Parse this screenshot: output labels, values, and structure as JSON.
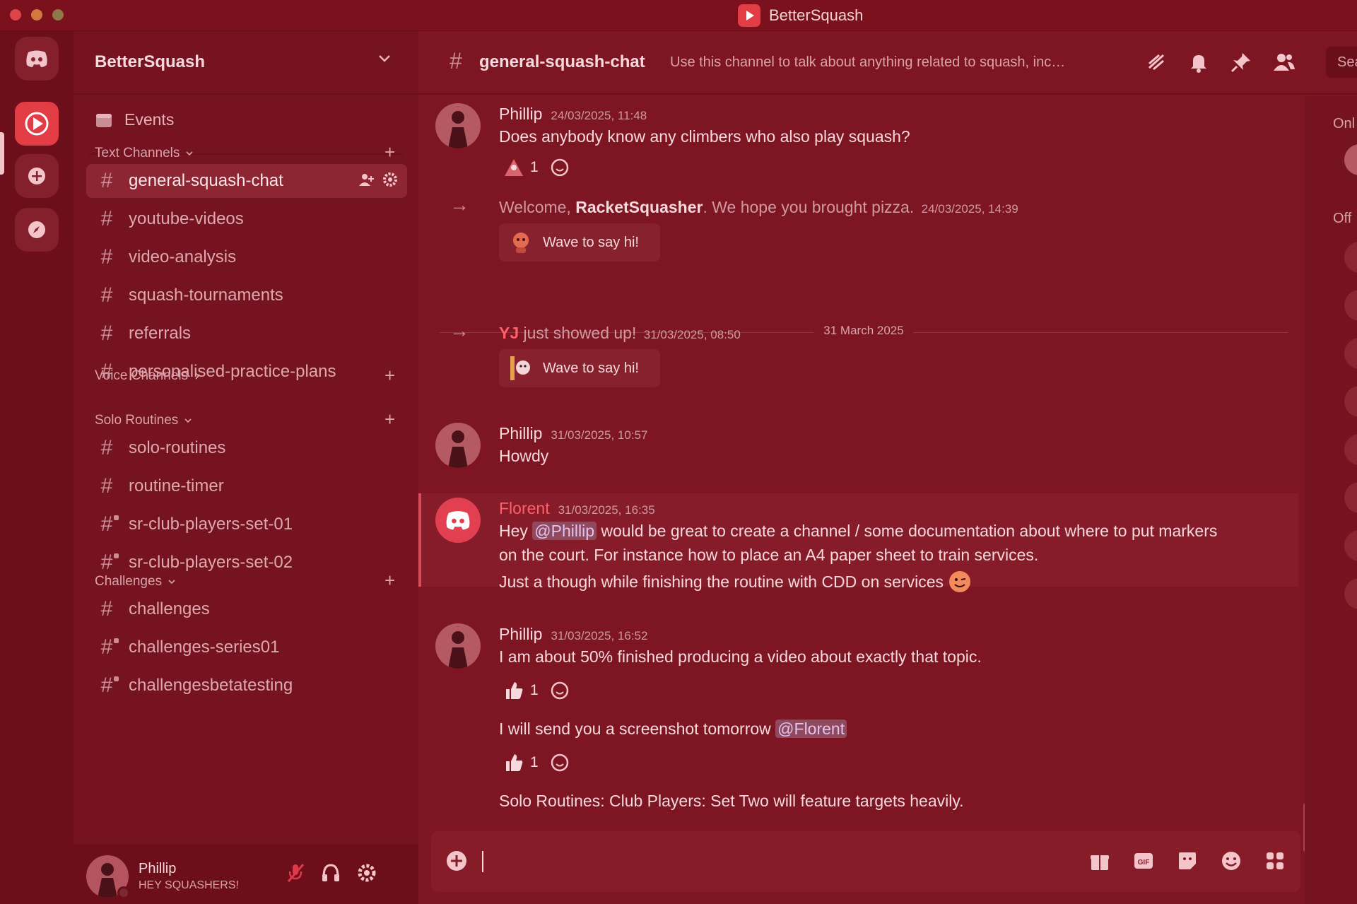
{
  "window": {
    "title": "BetterSquash"
  },
  "server": {
    "name": "BetterSquash",
    "events_label": "Events"
  },
  "categories": {
    "text": "Text Channels",
    "voice": "Voice Channels",
    "solo": "Solo Routines",
    "challenges": "Challenges"
  },
  "channels": {
    "text": [
      "general-squash-chat",
      "youtube-videos",
      "video-analysis",
      "squash-tournaments",
      "referrals",
      "personalised-practice-plans"
    ],
    "solo": [
      "solo-routines",
      "routine-timer",
      "sr-club-players-set-01",
      "sr-club-players-set-02"
    ],
    "challenges": [
      "challenges",
      "challenges-series01",
      "challengesbetatesting"
    ]
  },
  "user": {
    "name": "Phillip",
    "status": "HEY SQUASHERS!"
  },
  "header": {
    "channel": "general-squash-chat",
    "topic": "Use this channel to talk about anything related to squash, includin...",
    "search_placeholder": "Sea"
  },
  "members": {
    "online_label": "Onl",
    "offline_label": "Off"
  },
  "messages": {
    "m1": {
      "author": "Phillip",
      "time": "24/03/2025, 11:48",
      "text": "Does anybody know any climbers who also play squash?",
      "reaction_count": "1"
    },
    "sys1": {
      "pre": "Welcome, ",
      "name": "RacketSquasher",
      "post": ". We hope you brought pizza.",
      "time": "24/03/2025, 14:39",
      "wave": "Wave to say hi!"
    },
    "date_divider": "31 March 2025",
    "sys2": {
      "name": "YJ",
      "post": " just showed up!",
      "time": "31/03/2025, 08:50",
      "wave": "Wave to say hi!"
    },
    "m2": {
      "author": "Phillip",
      "time": "31/03/2025, 10:57",
      "text": "Howdy"
    },
    "m3": {
      "author": "Florent",
      "time": "31/03/2025, 16:35",
      "line1_pre": "Hey ",
      "mention": "@Phillip",
      "line1_post": " would be great to create a channel / some documentation about where to put markers",
      "line2": "on the court. For instance how to place an A4 paper sheet to train services.",
      "line3": "Just a though while finishing the routine with CDD on services"
    },
    "m4": {
      "author": "Phillip",
      "time": "31/03/2025, 16:52",
      "text": "I am about 50% finished producing a video about exactly that topic.",
      "reaction_count": "1",
      "text2_pre": "I will send you a screenshot tomorrow ",
      "mention2": "@Florent",
      "reaction2_count": "1",
      "text3": "Solo Routines: Club Players: Set Two will feature targets heavily."
    }
  },
  "colors": {
    "background": "#7d1522",
    "accent": "#e23c45",
    "mention_author": "#ff5e6b"
  }
}
